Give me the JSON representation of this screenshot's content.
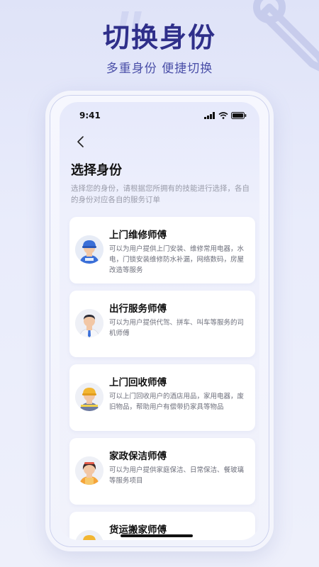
{
  "promo": {
    "headline": "切换身份",
    "subline": "多重身份  便捷切换"
  },
  "statusbar": {
    "time": "9:41",
    "icons": [
      "signal-icon",
      "wifi-icon",
      "battery-icon"
    ]
  },
  "page": {
    "title": "选择身份",
    "description": "选择您的身份，请根据您所拥有的技能进行选择，各自的身份对应各自的服务订单"
  },
  "cards": [
    {
      "title": "上门维修师傅",
      "desc": "可以为用户提供上门安装、维修常用电器，水电，门锁安装维修防水补漏，网络数码，房屋改造等服务",
      "icon": "repair-worker-avatar"
    },
    {
      "title": "出行服务师傅",
      "desc": "可以为用户提供代驾、拼车、叫车等服务的司机师傅",
      "icon": "driver-avatar"
    },
    {
      "title": "上门回收师傅",
      "desc": "可以上门回收用户的酒店用品，家用电器，废旧物品，帮助用户有偿带扔家具等物品",
      "icon": "recycler-avatar"
    },
    {
      "title": "家政保洁师傅",
      "desc": "可以为用户提供家庭保洁、日常保洁、餐玻璃等服务项目",
      "icon": "cleaner-avatar"
    },
    {
      "title": "货运搬家师傅",
      "desc": "",
      "icon": "mover-avatar"
    }
  ],
  "colors": {
    "headline": "#2f2f8a",
    "accent_blue": "#3a6fd8",
    "background": "#e9ecfb"
  }
}
